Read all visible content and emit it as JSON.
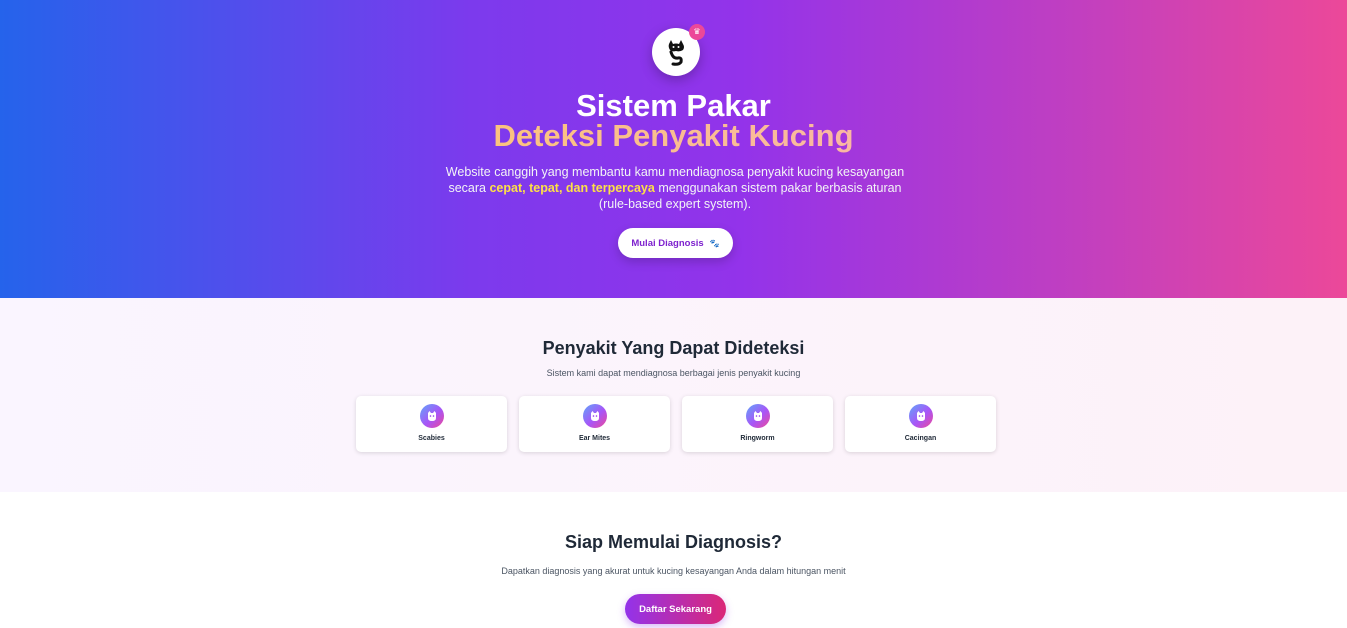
{
  "hero": {
    "title": "Sistem Pakar",
    "subtitle": "Deteksi Penyakit Kucing",
    "description_before": "Website canggih yang membantu kamu mendiagnosa penyakit kucing kesayangan secara ",
    "description_highlight": "cepat, tepat, dan terpercaya",
    "description_after": " menggunakan sistem pakar berbasis aturan (rule-based expert system).",
    "cta_label": "Mulai Diagnosis",
    "logo_icon": "cat-icon",
    "badge_icon": "crown-icon",
    "cta_icon": "paw-icon"
  },
  "diseases": {
    "title": "Penyakit Yang Dapat Dideteksi",
    "subtitle": "Sistem kami dapat mendiagnosa berbagai jenis penyakit kucing",
    "items": [
      {
        "label": "Scabies",
        "icon": "cat-icon"
      },
      {
        "label": "Ear Mites",
        "icon": "cat-icon"
      },
      {
        "label": "Ringworm",
        "icon": "cat-icon"
      },
      {
        "label": "Cacingan",
        "icon": "cat-icon"
      }
    ]
  },
  "ready": {
    "title": "Siap Memulai Diagnosis?",
    "subtitle": "Dapatkan diagnosis yang akurat untuk kucing kesayangan Anda dalam hitungan menit",
    "cta_label": "Daftar Sekarang"
  },
  "colors": {
    "hero_gradient": [
      "#2563eb",
      "#7c3aed",
      "#9333ea",
      "#ec4899"
    ],
    "highlight": "#fde047",
    "accent_purple": "#7e22ce",
    "accent_pink": "#db2777"
  }
}
